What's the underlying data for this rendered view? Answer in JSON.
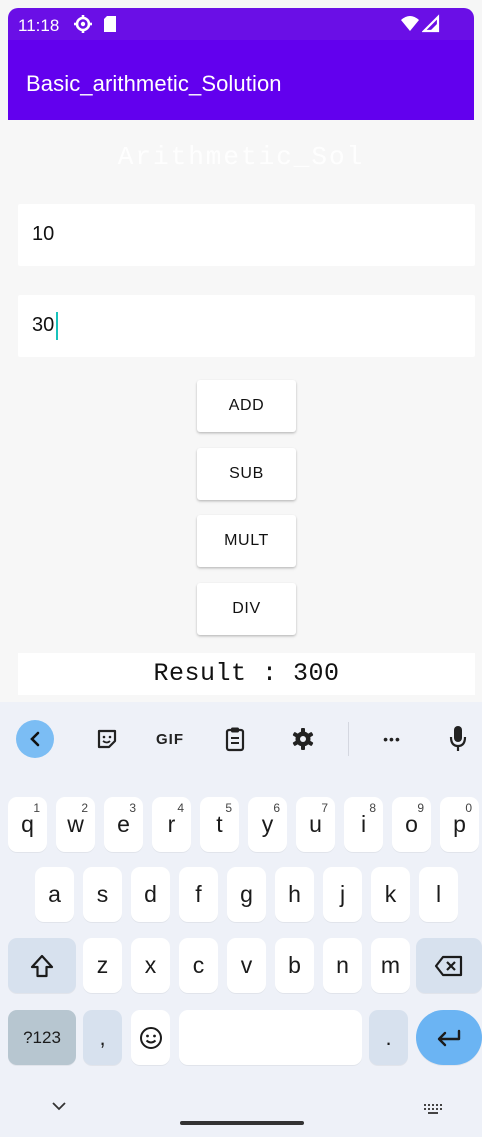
{
  "status_bar": {
    "time": "11:18"
  },
  "app_bar": {
    "title": "Basic_arithmetic_Solution"
  },
  "content": {
    "heading": "Arithmetic_Sol",
    "first_number": "10",
    "second_number": "30",
    "buttons": {
      "add": "ADD",
      "sub": "SUB",
      "mult": "MULT",
      "div": "DIV"
    },
    "result": "Result : 300"
  },
  "keyboard": {
    "toolbar": {
      "gif": "GIF",
      "more": "•••"
    },
    "row1": [
      {
        "letter": "q",
        "hint": "1"
      },
      {
        "letter": "w",
        "hint": "2"
      },
      {
        "letter": "e",
        "hint": "3"
      },
      {
        "letter": "r",
        "hint": "4"
      },
      {
        "letter": "t",
        "hint": "5"
      },
      {
        "letter": "y",
        "hint": "6"
      },
      {
        "letter": "u",
        "hint": "7"
      },
      {
        "letter": "i",
        "hint": "8"
      },
      {
        "letter": "o",
        "hint": "9"
      },
      {
        "letter": "p",
        "hint": "0"
      }
    ],
    "row2": [
      "a",
      "s",
      "d",
      "f",
      "g",
      "h",
      "j",
      "k",
      "l"
    ],
    "row3": [
      "z",
      "x",
      "c",
      "v",
      "b",
      "n",
      "m"
    ],
    "bottom": {
      "symbols": "?123",
      "comma": ",",
      "period": "."
    }
  },
  "colors": {
    "app_bar": "#6200ee",
    "status_bar": "#6a0fe6",
    "accent": "#6bb4f3"
  }
}
